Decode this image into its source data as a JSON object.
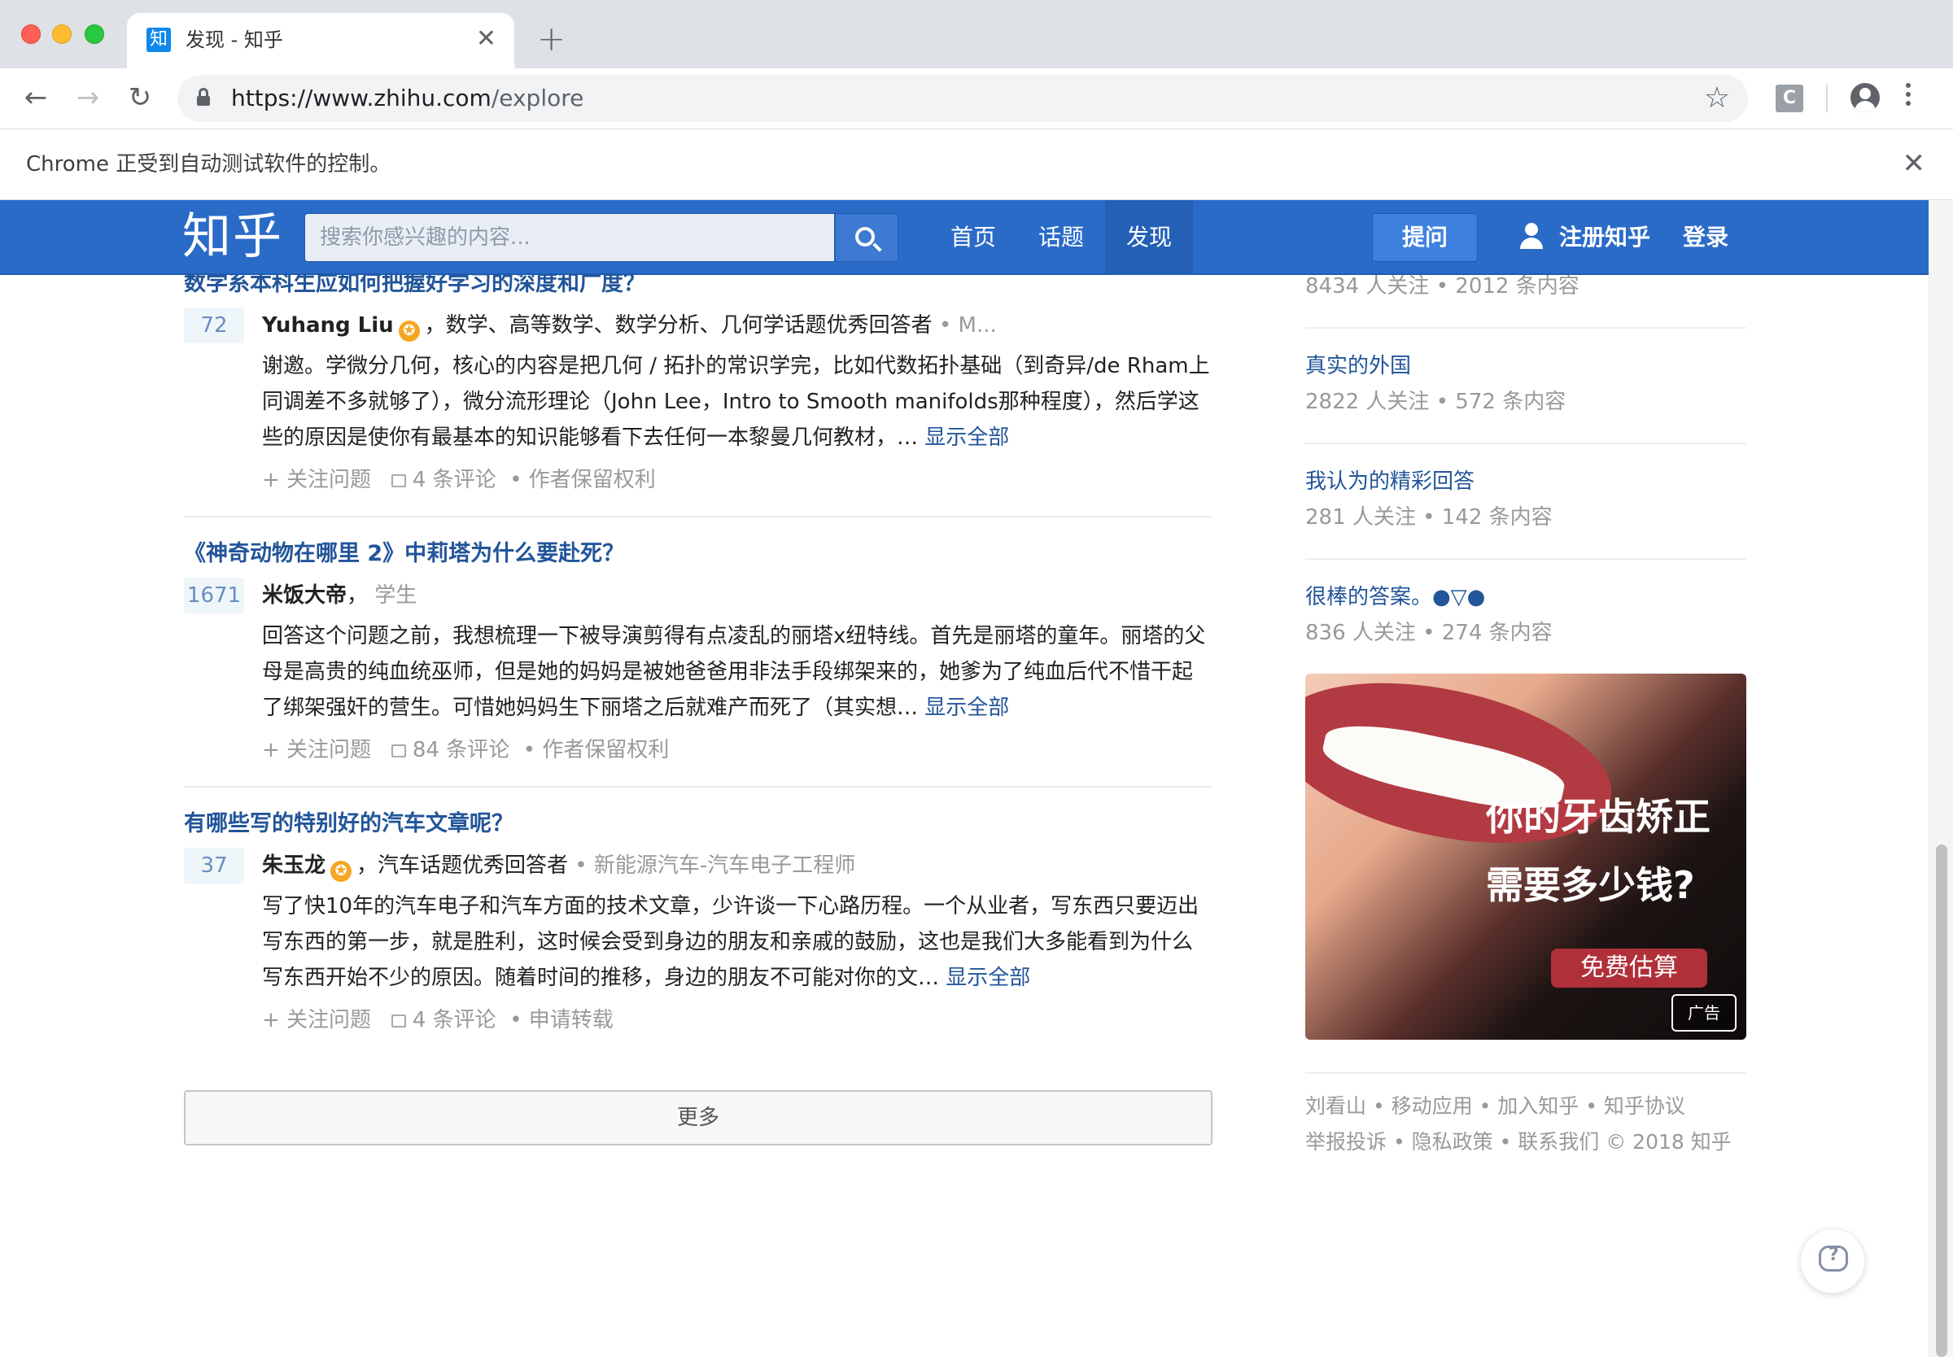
{
  "browser": {
    "tab_title": "发现 - 知乎",
    "favicon_text": "知",
    "close_tab": "✕",
    "new_tab": "+",
    "url_host": "https://www.zhihu.com",
    "url_path": "/explore",
    "ext_letter": "C",
    "automation_notice": "Chrome 正受到自动测试软件的控制。",
    "infobar_close": "✕"
  },
  "header": {
    "logo": "知乎",
    "search_placeholder": "搜索你感兴趣的内容...",
    "nav": [
      "首页",
      "话题",
      "发现"
    ],
    "active_nav": "发现",
    "ask_label": "提问",
    "register_label": "注册知乎",
    "login_label": "登录",
    "brand_color": "#2a6bc8"
  },
  "feed": {
    "items": [
      {
        "title": "数学系本科生应如何把握好学习的深度和广度？",
        "votes": "72",
        "author": "Yuhang Liu",
        "has_badge": true,
        "bio": "，数学、高等数学、数学分析、几何学话题优秀回答者",
        "bio_extra": " • M...",
        "excerpt": "谢邀。学微分几何，核心的内容是把几何 / 拓扑的常识学完，比如代数拓扑基础（到奇异/de Rham上同调差不多就够了），微分流形理论（John Lee，Intro to Smooth manifolds那种程度），然后学这些的原因是使你有最基本的知识能够看下去任何一本黎曼几何教材，…",
        "more": "显示全部",
        "follow": "+ 关注问题",
        "comments": "4 条评论",
        "rights": "• 作者保留权利"
      },
      {
        "title": "《神奇动物在哪里 2》中莉塔为什么要赴死？",
        "votes": "1671",
        "author": "米饭大帝",
        "has_badge": false,
        "bio": "，",
        "bio_extra": " 学生",
        "excerpt": "回答这个问题之前，我想梳理一下被导演剪得有点凌乱的丽塔x纽特线。首先是丽塔的童年。丽塔的父母是高贵的纯血统巫师，但是她的妈妈是被她爸爸用非法手段绑架来的，她爹为了纯血后代不惜干起了绑架强奸的营生。可惜她妈妈生下丽塔之后就难产而死了（其实想…",
        "more": "显示全部",
        "follow": "+ 关注问题",
        "comments": "84 条评论",
        "rights": "• 作者保留权利"
      },
      {
        "title": "有哪些写的特别好的汽车文章呢？",
        "votes": "37",
        "author": "朱玉龙",
        "has_badge": true,
        "bio": "，汽车话题优秀回答者",
        "bio_extra": " • 新能源汽车-汽车电子工程师",
        "excerpt": "写了快10年的汽车电子和汽车方面的技术文章，少许谈一下心路历程。一个从业者，写东西只要迈出写东西的第一步，就是胜利，这时候会受到身边的朋友和亲戚的鼓励，这也是我们大多能看到为什么写东西开始不少的原因。随着时间的推移，身边的朋友不可能对你的文…",
        "more": "显示全部",
        "follow": "+ 关注问题",
        "comments": "4 条评论",
        "rights": "• 申请转载"
      }
    ],
    "more_button": "更多"
  },
  "sidebar": {
    "top_meta": "8434 人关注 • 2012 条内容",
    "collections": [
      {
        "name": "真实的外国",
        "meta": "2822 人关注 • 572 条内容"
      },
      {
        "name": "我认为的精彩回答",
        "meta": "281 人关注 • 142 条内容"
      },
      {
        "name": "很棒的答案。●▽●",
        "meta": "836 人关注 • 274 条内容"
      }
    ],
    "ad": {
      "line1": "你的牙齿矫正",
      "line2": "需要多少钱?",
      "cta": "免费估算",
      "tag": "广告"
    },
    "footer_line1": "刘看山 • 移动应用 • 加入知乎 • 知乎协议",
    "footer_line2": "举报投诉 • 隐私政策 • 联系我们 © 2018 知乎"
  }
}
